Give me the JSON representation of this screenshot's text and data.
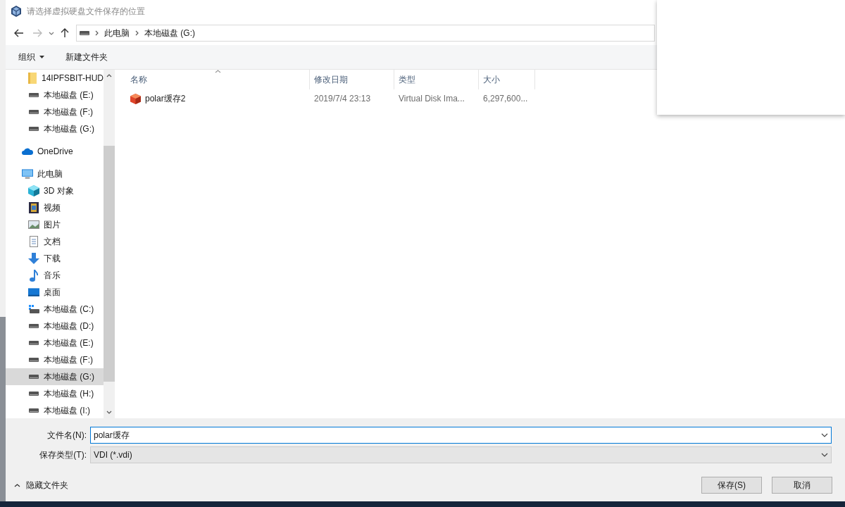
{
  "window": {
    "title": "请选择虚拟硬盘文件保存的位置"
  },
  "address": {
    "breadcrumbs": [
      "此电脑",
      "本地磁盘 (G:)"
    ]
  },
  "toolbar": {
    "organize": "组织",
    "new_folder": "新建文件夹"
  },
  "nav": {
    "continued_children": [
      {
        "label": "14IPFSBIT-HUD",
        "kind": "folder",
        "selected": false
      },
      {
        "label": "本地磁盘 (E:)",
        "kind": "drive",
        "selected": false
      },
      {
        "label": "本地磁盘 (F:)",
        "kind": "drive",
        "selected": false
      },
      {
        "label": "本地磁盘 (G:)",
        "kind": "drive",
        "selected": false
      }
    ],
    "items": [
      {
        "label": "OneDrive",
        "kind": "cloud",
        "selected": false
      },
      {
        "label": "此电脑",
        "kind": "pc",
        "selected": false,
        "children": [
          {
            "label": "3D 对象",
            "kind": "objects3d",
            "selected": false
          },
          {
            "label": "视频",
            "kind": "video",
            "selected": false
          },
          {
            "label": "图片",
            "kind": "pictures",
            "selected": false
          },
          {
            "label": "文档",
            "kind": "documents",
            "selected": false
          },
          {
            "label": "下载",
            "kind": "downloads",
            "selected": false
          },
          {
            "label": "音乐",
            "kind": "music",
            "selected": false
          },
          {
            "label": "桌面",
            "kind": "desktop",
            "selected": false
          },
          {
            "label": "本地磁盘 (C:)",
            "kind": "system-drive",
            "selected": false
          },
          {
            "label": "本地磁盘 (D:)",
            "kind": "drive",
            "selected": false
          },
          {
            "label": "本地磁盘 (E:)",
            "kind": "drive",
            "selected": false
          },
          {
            "label": "本地磁盘 (F:)",
            "kind": "drive",
            "selected": false
          },
          {
            "label": "本地磁盘 (G:)",
            "kind": "drive",
            "selected": true
          },
          {
            "label": "本地磁盘 (H:)",
            "kind": "drive",
            "selected": false
          },
          {
            "label": "本地磁盘 (I:)",
            "kind": "drive",
            "selected": false
          }
        ]
      }
    ]
  },
  "table": {
    "columns": [
      "名称",
      "修改日期",
      "类型",
      "大小"
    ],
    "rows": [
      {
        "cells": [
          "polar缓存2",
          "2019/7/4 23:13",
          "Virtual Disk Ima...",
          "6,297,600..."
        ]
      }
    ]
  },
  "form": {
    "filename_label": "文件名(N):",
    "filename_value": "polar缓存",
    "type_label": "保存类型(T):",
    "type_value": "VDI (*.vdi)"
  },
  "footer": {
    "hide_folders": "隐藏文件夹",
    "buttons": [
      "保存(S)",
      "取消"
    ]
  }
}
